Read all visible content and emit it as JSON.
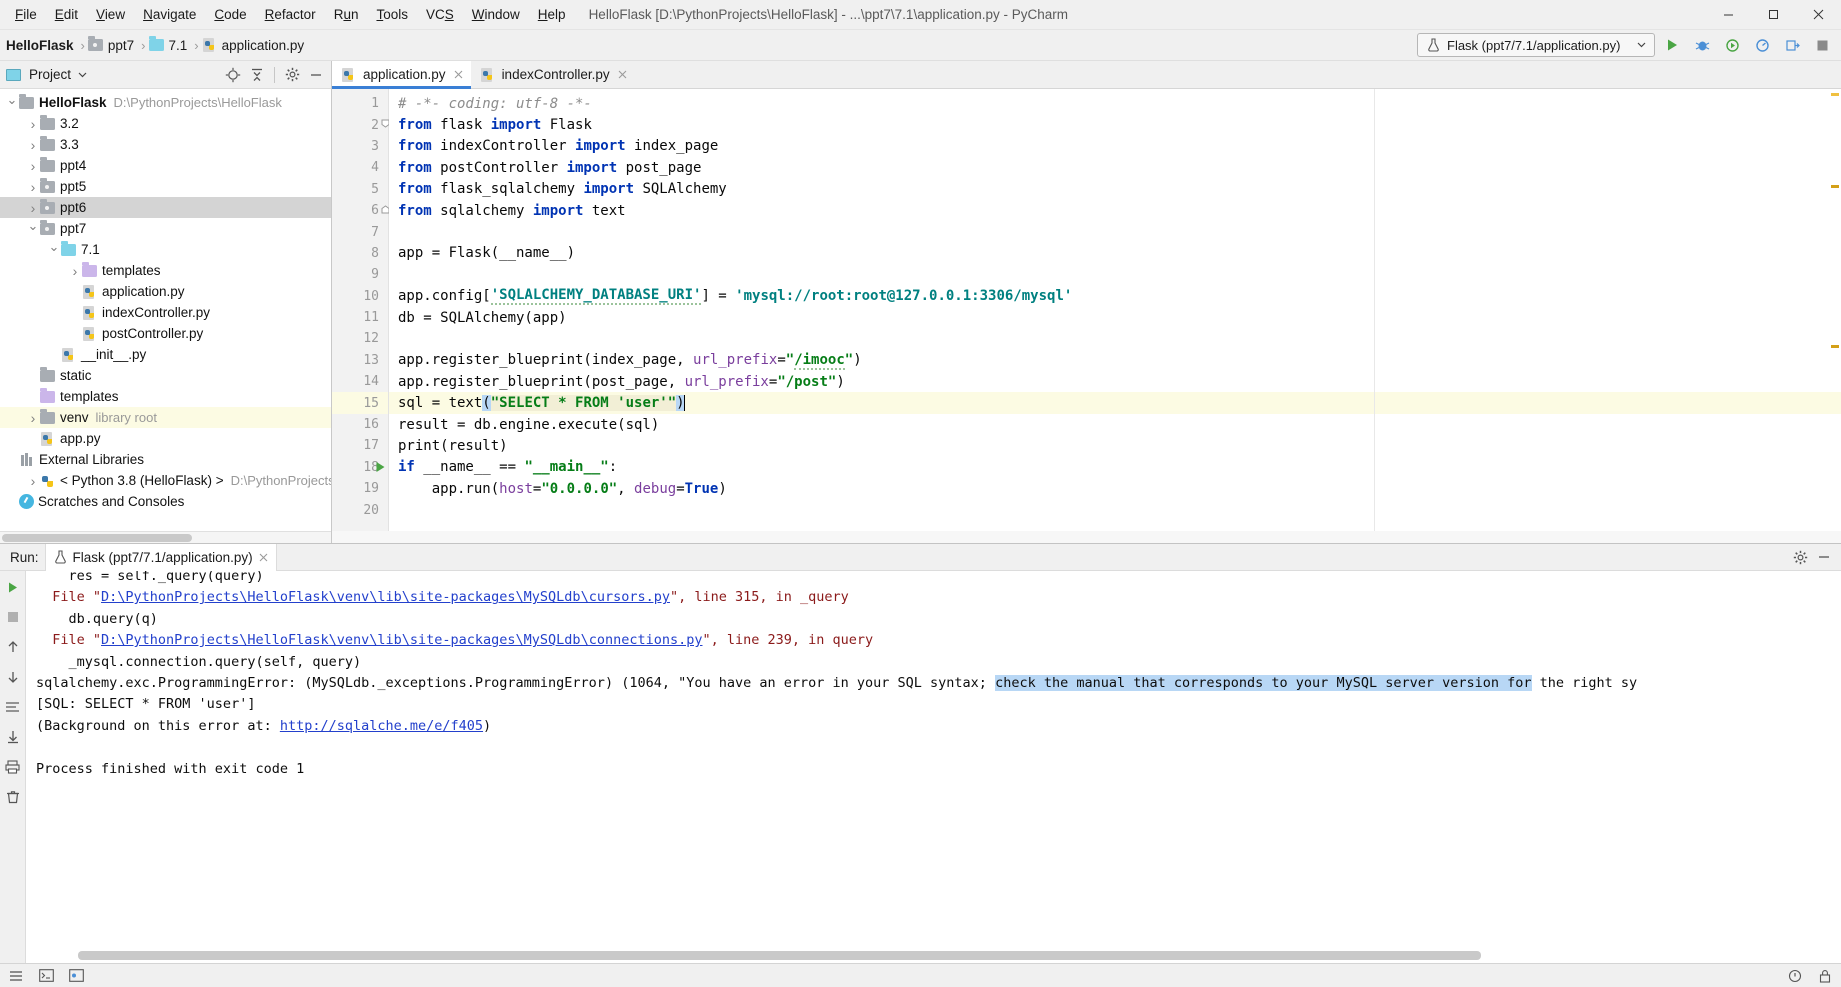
{
  "window": {
    "title": "HelloFlask [D:\\PythonProjects\\HelloFlask] - ...\\ppt7\\7.1\\application.py - PyCharm",
    "minimize_icon": "minimize-icon",
    "maximize_icon": "maximize-icon",
    "close_icon": "close-icon"
  },
  "menubar": {
    "items": [
      {
        "label": "File"
      },
      {
        "label": "Edit"
      },
      {
        "label": "View"
      },
      {
        "label": "Navigate"
      },
      {
        "label": "Code"
      },
      {
        "label": "Refactor"
      },
      {
        "label": "Run"
      },
      {
        "label": "Tools"
      },
      {
        "label": "VCS"
      },
      {
        "label": "Window"
      },
      {
        "label": "Help"
      }
    ]
  },
  "breadcrumb": {
    "items": [
      {
        "label": "HelloFlask",
        "icon": "none",
        "bold": true
      },
      {
        "label": "ppt7",
        "icon": "folder-gray"
      },
      {
        "label": "7.1",
        "icon": "folder-blue"
      },
      {
        "label": "application.py",
        "icon": "python-file"
      }
    ],
    "separator": "›"
  },
  "run_config": {
    "name": "Flask (ppt7/7.1/application.py)",
    "icon": "flask-icon",
    "dropdown_icon": "chevron-down-icon",
    "buttons": [
      {
        "name": "run-button",
        "icon": "play-icon",
        "color": "#4aa544"
      },
      {
        "name": "debug-button",
        "icon": "bug-icon",
        "color": "#4b8fd6"
      },
      {
        "name": "run-coverage-button",
        "icon": "coverage-icon",
        "color": "#4aa544"
      },
      {
        "name": "profile-button",
        "icon": "profile-icon",
        "color": "#4b8fd6"
      },
      {
        "name": "attach-button",
        "icon": "attach-icon",
        "color": "#4b8fd6"
      },
      {
        "name": "stop-button",
        "icon": "stop-icon",
        "color": "#8a8a8a"
      }
    ]
  },
  "project_panel": {
    "title": "Project",
    "caret_icon": "chevron-down-icon",
    "header_icons": [
      {
        "name": "locate-icon"
      },
      {
        "name": "collapse-all-icon"
      },
      {
        "name": "settings-gear-icon"
      },
      {
        "name": "hide-panel-icon"
      }
    ],
    "tree": [
      {
        "depth": 0,
        "arrow": "open",
        "icon": "folder-gray",
        "label": "HelloFlask",
        "bold": true,
        "note": "D:\\PythonProjects\\HelloFlask",
        "state": "normal"
      },
      {
        "depth": 1,
        "arrow": "closed",
        "icon": "folder-gray",
        "label": "3.2",
        "note": "",
        "state": "normal"
      },
      {
        "depth": 1,
        "arrow": "closed",
        "icon": "folder-gray",
        "label": "3.3",
        "note": "",
        "state": "normal"
      },
      {
        "depth": 1,
        "arrow": "closed",
        "icon": "folder-gray",
        "label": "ppt4",
        "note": "",
        "state": "normal"
      },
      {
        "depth": 1,
        "arrow": "closed",
        "icon": "folder-gray-dot",
        "label": "ppt5",
        "note": "",
        "state": "normal"
      },
      {
        "depth": 1,
        "arrow": "closed",
        "icon": "folder-gray-dot",
        "label": "ppt6",
        "note": "",
        "state": "selected-gray"
      },
      {
        "depth": 1,
        "arrow": "open",
        "icon": "folder-gray-dot",
        "label": "ppt7",
        "note": "",
        "state": "normal"
      },
      {
        "depth": 2,
        "arrow": "open",
        "icon": "folder-blue",
        "label": "7.1",
        "note": "",
        "state": "normal"
      },
      {
        "depth": 3,
        "arrow": "closed",
        "icon": "folder-purple",
        "label": "templates",
        "note": "",
        "state": "normal"
      },
      {
        "depth": 3,
        "arrow": "none",
        "icon": "python-file",
        "label": "application.py",
        "note": "",
        "state": "normal"
      },
      {
        "depth": 3,
        "arrow": "none",
        "icon": "python-file",
        "label": "indexController.py",
        "note": "",
        "state": "normal"
      },
      {
        "depth": 3,
        "arrow": "none",
        "icon": "python-file",
        "label": "postController.py",
        "note": "",
        "state": "normal"
      },
      {
        "depth": 2,
        "arrow": "none",
        "icon": "python-file",
        "label": "__init__.py",
        "note": "",
        "state": "normal"
      },
      {
        "depth": 1,
        "arrow": "none",
        "icon": "folder-gray",
        "label": "static",
        "note": "",
        "state": "normal"
      },
      {
        "depth": 1,
        "arrow": "none",
        "icon": "folder-purple",
        "label": "templates",
        "note": "",
        "state": "normal"
      },
      {
        "depth": 1,
        "arrow": "closed",
        "icon": "folder-gray",
        "label": "venv",
        "note": "library root",
        "state": "selected-yellow"
      },
      {
        "depth": 1,
        "arrow": "none",
        "icon": "python-file",
        "label": "app.py",
        "note": "",
        "state": "normal"
      },
      {
        "depth": 0,
        "arrow": "none",
        "icon": "external-libraries",
        "label": "External Libraries",
        "note": "",
        "state": "normal"
      },
      {
        "depth": 1,
        "arrow": "closed",
        "icon": "interpreter",
        "label": "< Python 3.8 (HelloFlask) >",
        "note": "D:\\PythonProjects",
        "state": "normal"
      },
      {
        "depth": 0,
        "arrow": "none",
        "icon": "scratches",
        "label": "Scratches and Consoles",
        "note": "",
        "state": "normal"
      }
    ]
  },
  "editor": {
    "tabs": [
      {
        "label": "application.py",
        "icon": "python-file",
        "active": true,
        "close_icon": "close-icon"
      },
      {
        "label": "indexController.py",
        "icon": "python-file",
        "active": false,
        "close_icon": "close-icon"
      }
    ],
    "line_numbers": [
      "1",
      "2",
      "3",
      "4",
      "5",
      "6",
      "7",
      "8",
      "9",
      "10",
      "11",
      "12",
      "13",
      "14",
      "15",
      "16",
      "17",
      "18",
      "19",
      "20"
    ],
    "highlighted_line": 15,
    "run_marker_line": 18,
    "lines": [
      {
        "n": 1,
        "text": "# -*- coding: utf-8 -*-"
      },
      {
        "n": 2,
        "text": "from flask import Flask"
      },
      {
        "n": 3,
        "text": "from indexController import index_page"
      },
      {
        "n": 4,
        "text": "from postController import post_page"
      },
      {
        "n": 5,
        "text": "from flask_sqlalchemy import SQLAlchemy"
      },
      {
        "n": 6,
        "text": "from sqlalchemy import text"
      },
      {
        "n": 7,
        "text": ""
      },
      {
        "n": 8,
        "text": "app = Flask(__name__)"
      },
      {
        "n": 9,
        "text": ""
      },
      {
        "n": 10,
        "text": "app.config['SQLALCHEMY_DATABASE_URI'] = 'mysql://root:root@127.0.0.1:3306/mysql'"
      },
      {
        "n": 11,
        "text": "db = SQLAlchemy(app)"
      },
      {
        "n": 12,
        "text": ""
      },
      {
        "n": 13,
        "text": "app.register_blueprint(index_page, url_prefix=\"/imooc\")"
      },
      {
        "n": 14,
        "text": "app.register_blueprint(post_page, url_prefix=\"/post\")"
      },
      {
        "n": 15,
        "text": "sql = text(\"SELECT * FROM 'user'\")"
      },
      {
        "n": 16,
        "text": "result = db.engine.execute(sql)"
      },
      {
        "n": 17,
        "text": "print(result)"
      },
      {
        "n": 18,
        "text": "if __name__ == \"__main__\":"
      },
      {
        "n": 19,
        "text": "    app.run(host=\"0.0.0.0\", debug=True)"
      },
      {
        "n": 20,
        "text": ""
      }
    ]
  },
  "run_panel": {
    "label": "Run:",
    "tab_label": "Flask (ppt7/7.1/application.py)",
    "tab_icon": "flask-icon",
    "tab_close_icon": "close-icon",
    "header_icons": [
      {
        "name": "settings-gear-icon"
      },
      {
        "name": "hide-panel-icon"
      }
    ],
    "toolbar_icons": [
      {
        "name": "rerun-icon"
      },
      {
        "name": "stop-icon"
      },
      {
        "name": "up-arrow-icon"
      },
      {
        "name": "down-arrow-icon"
      },
      {
        "name": "soft-wrap-icon"
      },
      {
        "name": "scroll-to-end-icon"
      },
      {
        "name": "print-icon"
      },
      {
        "name": "clear-all-icon"
      }
    ],
    "console_lines": [
      {
        "type": "plain",
        "text": "    res = self._query(query)",
        "clipped": true
      },
      {
        "type": "file",
        "prefix": "  File \"",
        "link": "D:\\PythonProjects\\HelloFlask\\venv\\lib\\site-packages\\MySQLdb\\cursors.py",
        "suffix": "\", line 315, in _query"
      },
      {
        "type": "plain",
        "text": "    db.query(q)"
      },
      {
        "type": "file",
        "prefix": "  File \"",
        "link": "D:\\PythonProjects\\HelloFlask\\venv\\lib\\site-packages\\MySQLdb\\connections.py",
        "suffix": "\", line 239, in query"
      },
      {
        "type": "plain",
        "text": "    _mysql.connection.query(self, query)"
      },
      {
        "type": "error_sel",
        "pre": "sqlalchemy.exc.ProgrammingError: (MySQLdb._exceptions.ProgrammingError) (1064, \"You have an error in your SQL syntax; ",
        "sel": "check the manual that corresponds to your MySQL server version for",
        "post": " the right sy"
      },
      {
        "type": "error",
        "text": "[SQL: SELECT * FROM 'user']"
      },
      {
        "type": "bg_link",
        "prefix": "(Background on this error at: ",
        "link": "http://sqlalche.me/e/f405",
        "suffix": ")"
      },
      {
        "type": "blank",
        "text": ""
      },
      {
        "type": "plain",
        "text": "Process finished with exit code 1"
      }
    ]
  },
  "statusbar": {
    "left_items": [],
    "right_items": []
  }
}
